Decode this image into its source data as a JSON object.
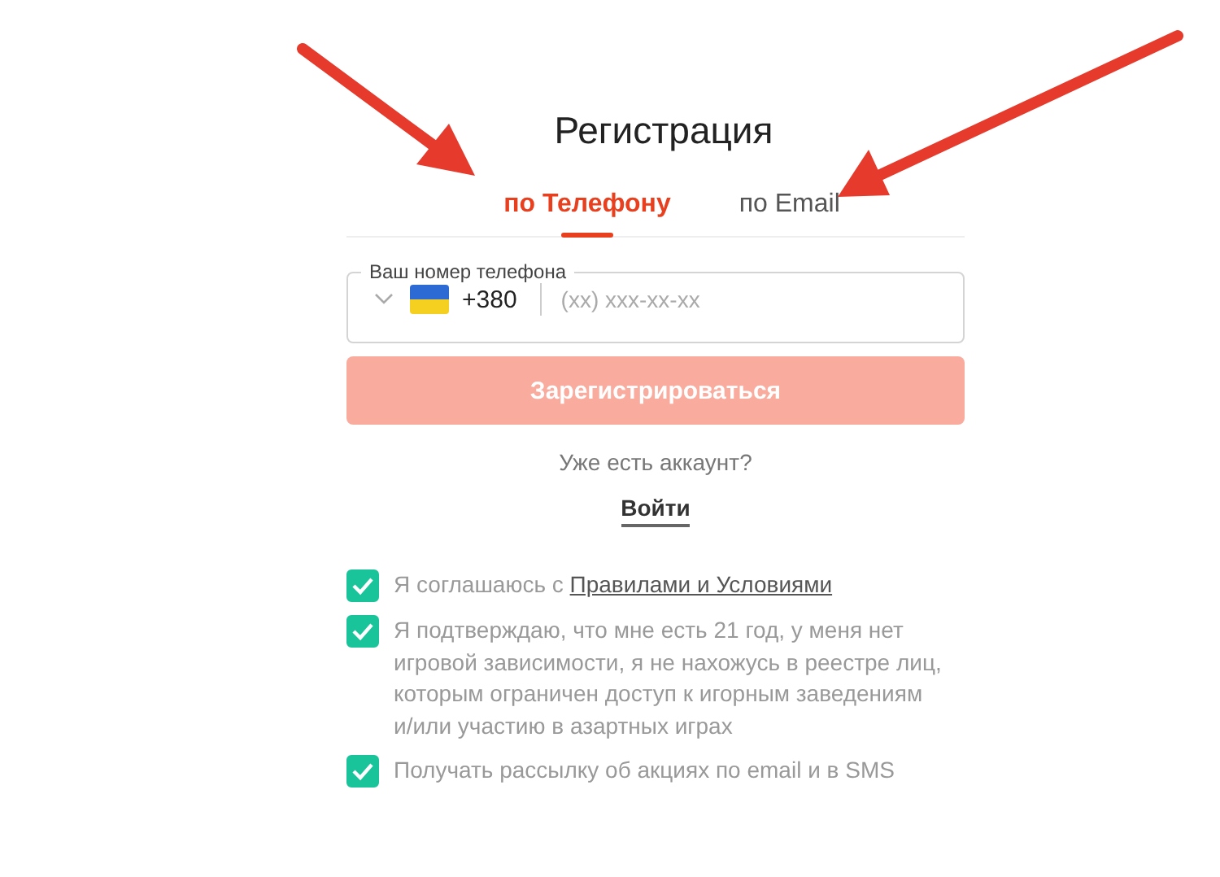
{
  "title": "Регистрация",
  "tabs": [
    {
      "label": "по Телефону",
      "selected": true
    },
    {
      "label": "по Email",
      "selected": false
    }
  ],
  "phone_field": {
    "label": "Ваш номер телефона",
    "code": "+380",
    "placeholder": "(xx) xxx-xx-xx"
  },
  "submit_button": {
    "label": "Зарегистрироваться",
    "disabled": true
  },
  "login_prompt": "Уже есть аккаунт?",
  "login_link": "Войти",
  "agreements": [
    {
      "text": "Я соглашаюсь с ",
      "link": "Правилами и Условиями",
      "checked": true
    },
    {
      "text": "Я подтверждаю, что мне есть 21 год, у меня нет игровой зависимости, я не нахожусь в реестре лиц, которым ограничен доступ к игорным заведениям и/или участию в азартных играх",
      "checked": true
    },
    {
      "text": "Получать рассылку об акциях по email и в SMS",
      "checked": true
    }
  ]
}
